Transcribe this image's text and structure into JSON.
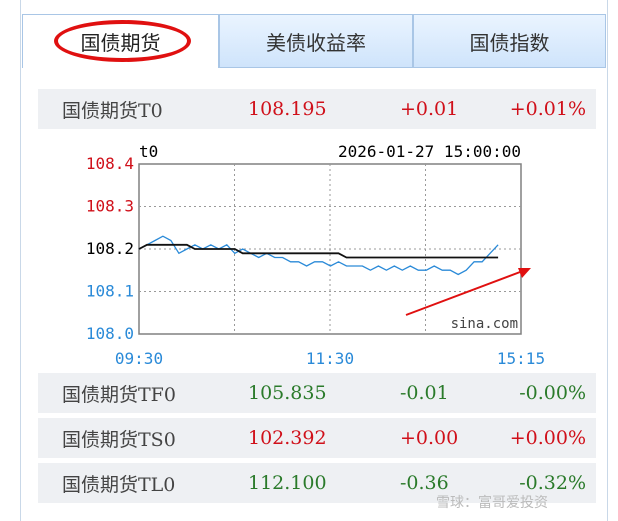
{
  "tabs": [
    {
      "label": "国债期货",
      "active": true
    },
    {
      "label": "美债收益率",
      "active": false
    },
    {
      "label": "国债指数",
      "active": false
    }
  ],
  "main_quote": {
    "name": "国债期货T0",
    "price": "108.195",
    "change": "+0.01",
    "pct": "+0.01%"
  },
  "chart": {
    "symbol": "t0",
    "datetime": "2026-01-27 15:00:00",
    "source": "sina.com",
    "y_ticks": [
      "108.4",
      "108.3",
      "108.2",
      "108.1",
      "108.0"
    ],
    "x_ticks": [
      "09:30",
      "11:30",
      "15:15"
    ]
  },
  "chart_data": {
    "type": "line",
    "title": "",
    "ylim": [
      108.0,
      108.4
    ],
    "series": [
      {
        "values": [
          108.2,
          108.21,
          108.22,
          108.23,
          108.22,
          108.19,
          108.2,
          108.21,
          108.2,
          108.21,
          108.2,
          108.21,
          108.19,
          108.2,
          108.19,
          108.18,
          108.19,
          108.18,
          108.18,
          108.17,
          108.17,
          108.16,
          108.17,
          108.17,
          108.16,
          108.17,
          108.16,
          108.16,
          108.16,
          108.15,
          108.16,
          108.15,
          108.16,
          108.15,
          108.16,
          108.15,
          108.15,
          108.16,
          108.15,
          108.15,
          108.14,
          108.15,
          108.17,
          108.17,
          108.19,
          108.21
        ]
      },
      {
        "values": [
          108.2,
          108.21,
          108.21,
          108.21,
          108.21,
          108.21,
          108.21,
          108.2,
          108.2,
          108.2,
          108.2,
          108.2,
          108.2,
          108.19,
          108.19,
          108.19,
          108.19,
          108.19,
          108.19,
          108.19,
          108.19,
          108.19,
          108.19,
          108.19,
          108.19,
          108.19,
          108.18,
          108.18,
          108.18,
          108.18,
          108.18,
          108.18,
          108.18,
          108.18,
          108.18,
          108.18,
          108.18,
          108.18,
          108.18,
          108.18,
          108.18,
          108.18,
          108.18,
          108.18,
          108.18,
          108.18
        ]
      }
    ]
  },
  "quotes": [
    {
      "name": "国债期货TF0",
      "price": "105.835",
      "change": "-0.01",
      "pct": "-0.00%"
    },
    {
      "name": "国债期货TS0",
      "price": "102.392",
      "change": "+0.00",
      "pct": "+0.00%"
    },
    {
      "name": "国债期货TL0",
      "price": "112.100",
      "change": "-0.36",
      "pct": "-0.32%"
    }
  ],
  "watermark": "雪球：富哥爱投资",
  "colors": {
    "up": "#d0101a",
    "down": "#2a7a2a",
    "tab_border": "#a9c6e6",
    "intraday_line": "#2a8ad8",
    "avg_line": "#111111",
    "annotation": "#e01010"
  }
}
